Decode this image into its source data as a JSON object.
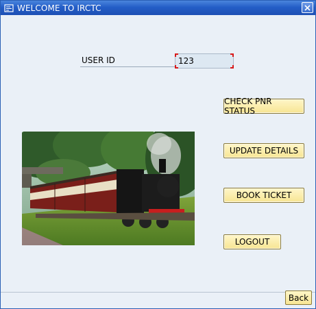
{
  "window": {
    "title": "WELCOME TO IRCTC",
    "title_icon": "window-menu-icon",
    "close_icon": "close-icon"
  },
  "form": {
    "user_id_label": "USER ID",
    "user_id_value": "123"
  },
  "buttons": {
    "check_pnr": "CHECK PNR STATUS",
    "update_details": "UPDATE DETAILS",
    "book_ticket": "BOOK TICKET",
    "logout": "LOGOUT",
    "back": "Back"
  },
  "image": {
    "subject": "steam-train-photo"
  },
  "colors": {
    "titlebar": "#245ec7",
    "button_face": "#f7e593",
    "background": "#eaf0f7",
    "focus_corner": "#d81919"
  }
}
